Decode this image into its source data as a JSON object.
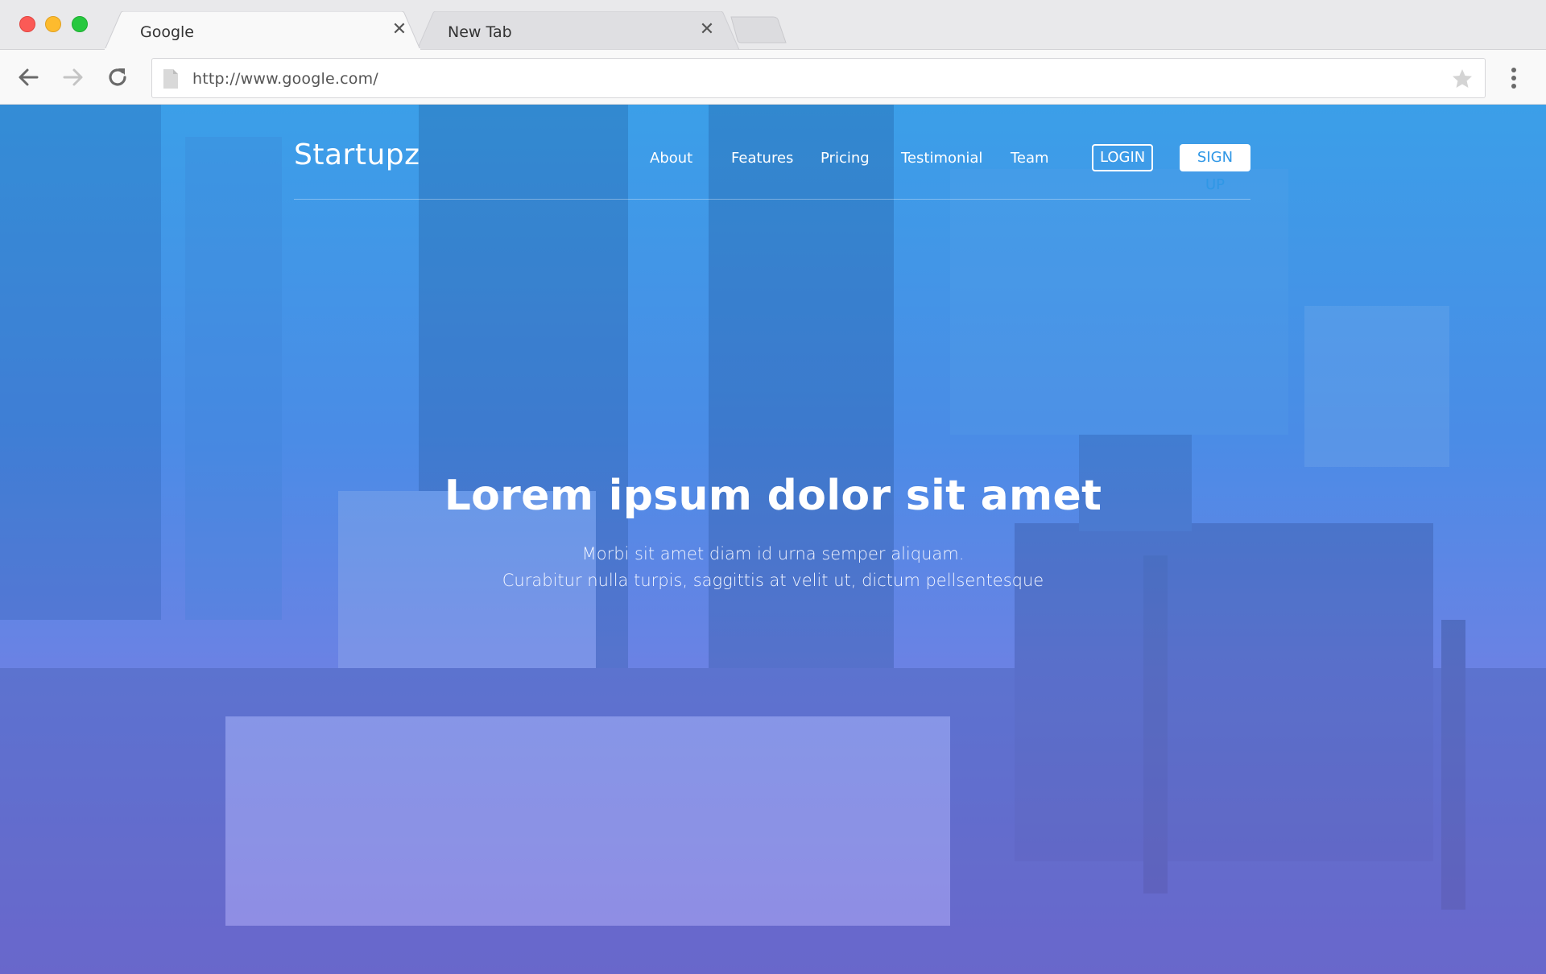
{
  "browser": {
    "tabs": [
      {
        "title": "Google",
        "active": true
      },
      {
        "title": "New Tab",
        "active": false
      }
    ],
    "close_glyph": "✕",
    "url": "http://www.google.com/",
    "icons": {
      "back": "arrow-left-icon",
      "forward": "arrow-right-icon",
      "reload": "reload-icon",
      "page": "page-icon",
      "bookmark": "star-icon",
      "menu": "vertical-dots-icon"
    },
    "traffic_colors": {
      "close": "#fb5a56",
      "minimize": "#fdbb2e",
      "maximize": "#27c83f"
    }
  },
  "site": {
    "brand": "Startupz",
    "nav": {
      "about": "About",
      "features": "Features",
      "pricing": "Pricing",
      "testimonial": "Testimonial",
      "team": "Team"
    },
    "login_label": "LOGIN",
    "signup_label": "SIGN UP",
    "hero": {
      "headline": "Lorem ipsum dolor sit amet",
      "sub_line_1": "Morbi sit amet diam id urna semper aliquam.",
      "sub_line_2": "Curabitur nulla turpis, saggittis at velit ut, dictum pellsentesque"
    },
    "colors": {
      "accent": "#2f97e6",
      "gradient_top": "#3b9fe8",
      "gradient_bottom": "#7c73de"
    }
  }
}
